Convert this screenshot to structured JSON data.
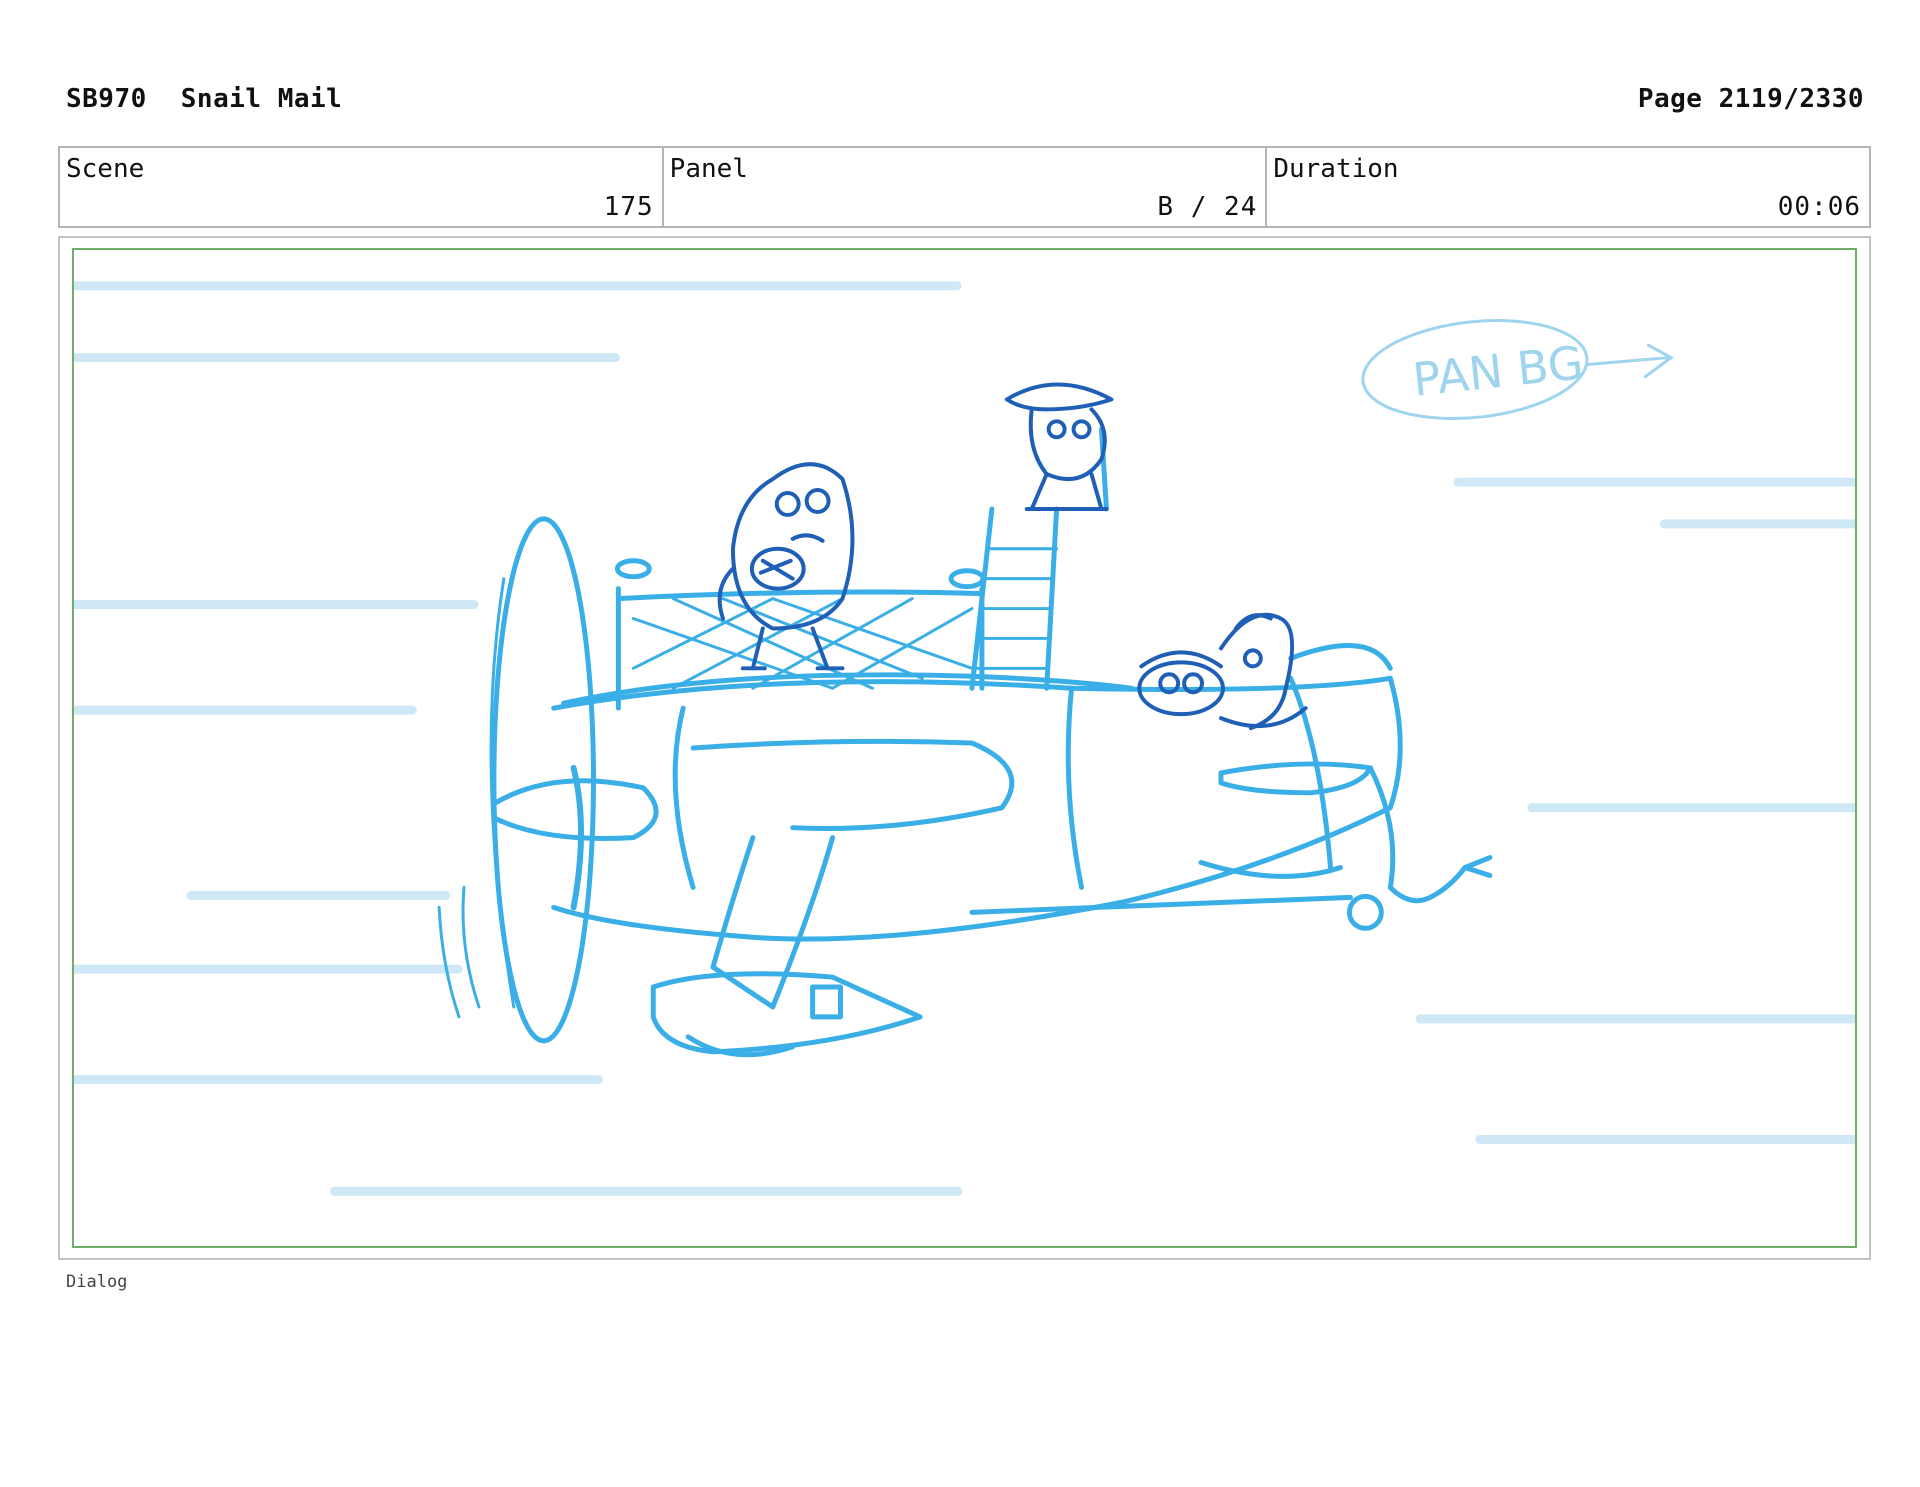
{
  "header": {
    "code": "SB970",
    "title": "Snail Mail",
    "page": "Page 2119/2330"
  },
  "info": {
    "scene_label": "Scene",
    "scene_value": "175",
    "panel_label": "Panel",
    "panel_value": "B / 24",
    "duration_label": "Duration",
    "duration_value": "00:06"
  },
  "sketch": {
    "note": "PAN BG",
    "colors": {
      "speed_lines": "#cfe8f6",
      "plane": "#3aaee6",
      "characters": "#1f5fb5",
      "note": "#9fd4ef",
      "frame": "#6fae6a"
    }
  },
  "dialog": {
    "label": "Dialog"
  }
}
